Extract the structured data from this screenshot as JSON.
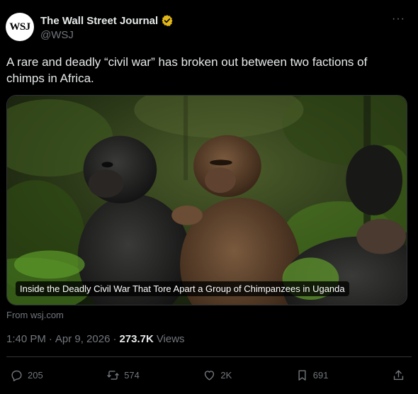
{
  "author": {
    "avatar_text": "WSJ",
    "name": "The Wall Street Journal",
    "handle": "@WSJ",
    "more_label": "···"
  },
  "tweet": {
    "text": "A rare and deadly “civil war” has broken out between two factions of chimps in Africa."
  },
  "card": {
    "caption": "Inside the Deadly Civil War That Tore Apart a Group of Chimpanzees in Uganda",
    "source": "From wsj.com"
  },
  "meta": {
    "time": "1:40 PM",
    "sep1": "·",
    "date": "Apr 9, 2026",
    "sep2": "·",
    "views_count": "273.7K",
    "views_label": "Views"
  },
  "actions": {
    "replies": "205",
    "reposts": "574",
    "likes": "2K",
    "bookmarks": "691"
  },
  "colors": {
    "background": "#000000",
    "text": "#e7e9ea",
    "muted": "#71767b",
    "verified": "#e2b719",
    "border": "#2f3336"
  },
  "icons": [
    "verified-badge-icon",
    "reply-icon",
    "repost-icon",
    "like-icon",
    "bookmark-icon",
    "share-icon"
  ]
}
